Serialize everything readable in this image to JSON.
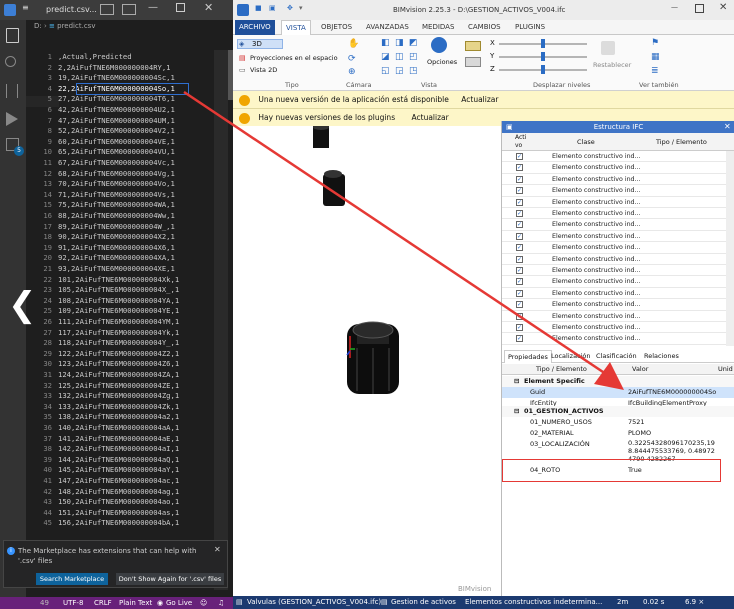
{
  "vscode": {
    "tab_label": "predict.csv...",
    "breadcrumb_prefix": "D:",
    "breadcrumb_file": "predict.csv",
    "lines": [
      {
        "num": "1",
        "text": ",Actual,Predicted"
      },
      {
        "num": "2",
        "text": "2,2AiFufTNE6M000000004RY,1"
      },
      {
        "num": "3",
        "text": "19,2AiFufTNE6M000000004Sc,1"
      },
      {
        "num": "4",
        "text": "22,2AiFufTNE6M000000004So,1"
      },
      {
        "num": "5",
        "text": "27,2AiFufTNE6M000000004T6,1"
      },
      {
        "num": "6",
        "text": "42,2AiFufTNE6M000000004U2,1"
      },
      {
        "num": "7",
        "text": "47,2AiFufTNE6M000000004UM,1"
      },
      {
        "num": "8",
        "text": "52,2AiFufTNE6M000000004V2,1"
      },
      {
        "num": "9",
        "text": "60,2AiFufTNE6M000000004VE,1"
      },
      {
        "num": "10",
        "text": "65,2AiFufTNE6M000000004VU,1"
      },
      {
        "num": "11",
        "text": "67,2AiFufTNE6M000000004Vc,1"
      },
      {
        "num": "12",
        "text": "68,2AiFufTNE6M000000004Vg,1"
      },
      {
        "num": "13",
        "text": "70,2AiFufTNE6M000000004Vo,1"
      },
      {
        "num": "14",
        "text": "71,2AiFufTNE6M000000004Vs,1"
      },
      {
        "num": "15",
        "text": "75,2AiFufTNE6M000000004WA,1"
      },
      {
        "num": "16",
        "text": "88,2AiFufTNE6M000000004Ww,1"
      },
      {
        "num": "17",
        "text": "89,2AiFufTNE6M000000004W_,1"
      },
      {
        "num": "18",
        "text": "90,2AiFufTNE6M000000004X2,1"
      },
      {
        "num": "19",
        "text": "91,2AiFufTNE6M000000004X6,1"
      },
      {
        "num": "20",
        "text": "92,2AiFufTNE6M000000004XA,1"
      },
      {
        "num": "21",
        "text": "93,2AiFufTNE6M000000004XE,1"
      },
      {
        "num": "22",
        "text": "101,2AiFufTNE6M000000004Xk,1"
      },
      {
        "num": "23",
        "text": "105,2AiFufTNE6M000000004X_,1"
      },
      {
        "num": "24",
        "text": "108,2AiFufTNE6M000000004YA,1"
      },
      {
        "num": "25",
        "text": "109,2AiFufTNE6M000000004YE,1"
      },
      {
        "num": "26",
        "text": "111,2AiFufTNE6M000000004YM,1"
      },
      {
        "num": "27",
        "text": "117,2AiFufTNE6M000000004Yk,1"
      },
      {
        "num": "28",
        "text": "118,2AiFufTNE6M000000004Y_,1"
      },
      {
        "num": "29",
        "text": "122,2AiFufTNE6M000000004Z2,1"
      },
      {
        "num": "30",
        "text": "123,2AiFufTNE6M000000004Z6,1"
      },
      {
        "num": "31",
        "text": "124,2AiFufTNE6M000000004ZA,1"
      },
      {
        "num": "32",
        "text": "125,2AiFufTNE6M000000004ZE,1"
      },
      {
        "num": "33",
        "text": "132,2AiFufTNE6M000000004Zg,1"
      },
      {
        "num": "34",
        "text": "133,2AiFufTNE6M000000004Zk,1"
      },
      {
        "num": "35",
        "text": "138,2AiFufTNE6M000000004a2,1"
      },
      {
        "num": "36",
        "text": "140,2AiFufTNE6M000000004aA,1"
      },
      {
        "num": "37",
        "text": "141,2AiFufTNE6M000000004aE,1"
      },
      {
        "num": "38",
        "text": "142,2AiFufTNE6M000000004aI,1"
      },
      {
        "num": "39",
        "text": "144,2AiFufTNE6M000000004aQ,1"
      },
      {
        "num": "40",
        "text": "145,2AiFufTNE6M000000004aY,1"
      },
      {
        "num": "41",
        "text": "147,2AiFufTNE6M000000004ac,1"
      },
      {
        "num": "42",
        "text": "148,2AiFufTNE6M000000004ag,1"
      },
      {
        "num": "43",
        "text": "150,2AiFufTNE6M000000004ao,1"
      },
      {
        "num": "44",
        "text": "151,2AiFufTNE6M000000004as,1"
      },
      {
        "num": "45",
        "text": "156,2AiFufTNE6M000000004bA,1"
      }
    ],
    "notification": {
      "message": "The Marketplace has extensions that can help with '.csv' files",
      "primary_button": "Search Marketplace",
      "secondary_button": "Don't Show Again for '.csv' files"
    },
    "status": {
      "line_num": "49",
      "encoding": "UTF-8",
      "eol": "CRLF",
      "language": "Plain Text",
      "golive": "Go Live"
    },
    "badge_count": "5"
  },
  "bim": {
    "title": "BIMvision 2.25.3 - D:\\GESTION_ACTIVOS_V004.ifc",
    "tabs": [
      "ARCHIVO",
      "VISTA",
      "OBJETOS",
      "AVANZADAS",
      "MEDIDAS",
      "CAMBIOS",
      "PLUGINS"
    ],
    "ribbon": {
      "view_3d": "3D",
      "projections": "Proyecciones en el espacio",
      "view_2d": "Vista 2D",
      "group_tipo": "Tipo",
      "group_camara": "Cámara",
      "opciones": "Opciones",
      "group_vista": "Vista",
      "x_label": "X",
      "y_label": "Y",
      "z_label": "Z",
      "restablecer": "Restablecer",
      "group_desplazar": "Desplazar niveles",
      "group_ver": "Ver también"
    },
    "info1": {
      "text": "Una nueva versión de la aplicación está disponible",
      "link": "Actualizar"
    },
    "info2": {
      "text": "Hay nuevas versiones de los plugins",
      "link": "Actualizar"
    },
    "ifc_panel": {
      "title": "Estructura IFC",
      "col_active": "Acti vo",
      "col_class": "Clase",
      "col_type": "Tipo / Elemento",
      "row_label": "Elemento constructivo ind...",
      "row_count": 17
    },
    "props_panel": {
      "tabs": [
        "Propiedades",
        "Localización",
        "Clasificación",
        "Relaciones"
      ],
      "col_type": "Tipo / Elemento",
      "col_value": "Valor",
      "col_unit": "Unid",
      "section1": "Element Specific",
      "guid_label": "Guid",
      "guid_value": "2AiFufTNE6M000000004So",
      "entity_label": "IfcEntity",
      "entity_value": "IfcBuildingElementProxy",
      "section2": "01_GESTION_ACTIVOS",
      "row1_label": "01_NUMERO_USOS",
      "row1_value": "7521",
      "row2_label": "02_MATERIAL",
      "row2_value": "PLOMO",
      "row3_label": "03_LOCALIZACIÓN",
      "row3_value": "0.32254328096170235,198.844475533769, 0.489724790 4282267",
      "row4_label": "04_ROTO",
      "row4_value": "True"
    },
    "status": {
      "file": "Valvulas (GESTION_ACTIVOS_V004.ifc)",
      "mode": "Gestion de activos",
      "selection": "Elementos constructivos indetermina...",
      "count": "2m",
      "time": "0.02 s",
      "fps": "6.9 ×",
      "brand": "BIMvision"
    }
  },
  "colors": {
    "vscode_bg": "#1e1e1e",
    "annotation_red": "#e53935",
    "bim_status_bg": "#1c3a70"
  }
}
